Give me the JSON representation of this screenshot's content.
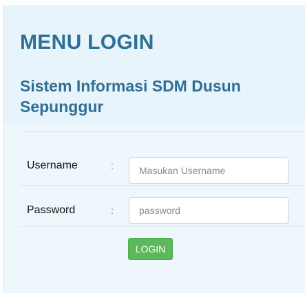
{
  "header": {
    "title": "MENU LOGIN",
    "subtitle": "Sistem Informasi SDM Dusun Sepunggur"
  },
  "form": {
    "username_label": "Username",
    "username_separator": ":",
    "username_placeholder": "Masukan Username",
    "username_value": "",
    "password_label": "Password",
    "password_separator": ":",
    "password_placeholder": "password",
    "password_value": "",
    "submit_label": "LOGIN"
  },
  "colors": {
    "heading_bg": "#e8f4fb",
    "body_bg": "#eef7fc",
    "title_text": "#2f6f93",
    "button_bg": "#5cb85c"
  }
}
